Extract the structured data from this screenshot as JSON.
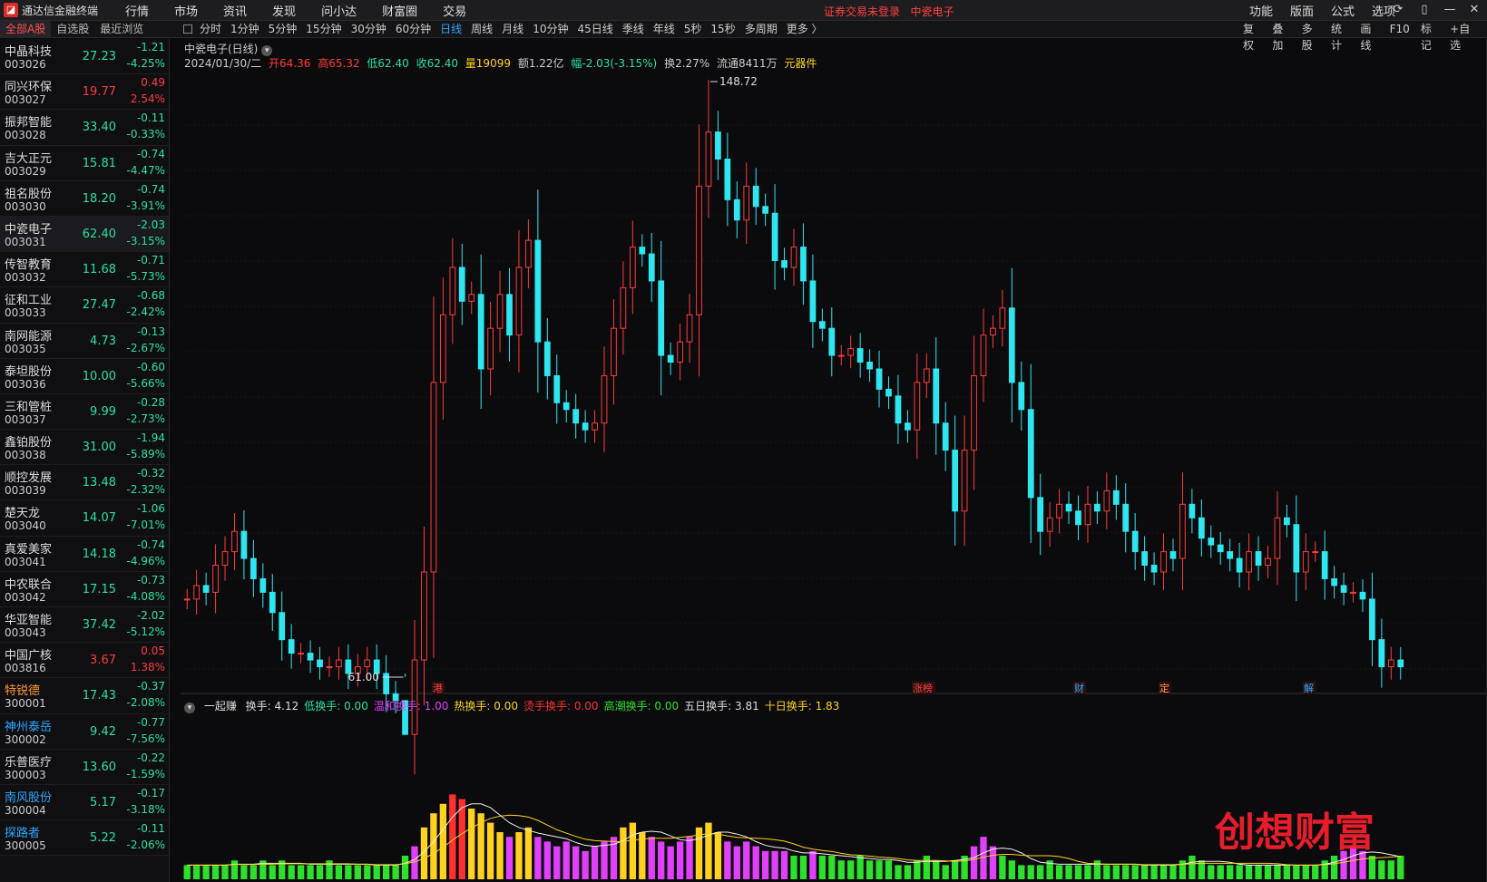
{
  "titlebar": {
    "app_title": "通达信金融终端",
    "menu": [
      "行情",
      "市场",
      "资讯",
      "发现",
      "问小达",
      "财富圈",
      "交易"
    ],
    "login_warning": "证券交易未登录",
    "login_stock": "中瓷电子",
    "sys_menu": [
      "功能",
      "版面",
      "公式",
      "选项"
    ]
  },
  "toolbar": {
    "stock_tabs": [
      "全部A股",
      "自选股",
      "最近浏览"
    ],
    "periods": [
      "分时",
      "1分钟",
      "5分钟",
      "15分钟",
      "30分钟",
      "60分钟",
      "日线",
      "周线",
      "月线",
      "10分钟",
      "45日线",
      "季线",
      "年线",
      "5秒",
      "15秒",
      "多周期",
      "更多 〉"
    ],
    "active_period": "日线",
    "right_tools": [
      "复权",
      "叠加",
      "多股",
      "统计",
      "画线",
      "F10",
      "标记",
      "+自选"
    ]
  },
  "stocks": [
    {
      "name": "中晶科技",
      "code": "003026",
      "price": "27.23",
      "chg": "-1.21",
      "pct": "-4.25%",
      "dir": "dn"
    },
    {
      "name": "同兴环保",
      "code": "003027",
      "price": "19.77",
      "chg": "0.49",
      "pct": "2.54%",
      "dir": "up"
    },
    {
      "name": "振邦智能",
      "code": "003028",
      "price": "33.40",
      "chg": "-0.11",
      "pct": "-0.33%",
      "dir": "dn"
    },
    {
      "name": "吉大正元",
      "code": "003029",
      "price": "15.81",
      "chg": "-0.74",
      "pct": "-4.47%",
      "dir": "dn"
    },
    {
      "name": "祖名股份",
      "code": "003030",
      "price": "18.20",
      "chg": "-0.74",
      "pct": "-3.91%",
      "dir": "dn"
    },
    {
      "name": "中瓷电子",
      "code": "003031",
      "price": "62.40",
      "chg": "-2.03",
      "pct": "-3.15%",
      "dir": "dn",
      "selected": true
    },
    {
      "name": "传智教育",
      "code": "003032",
      "price": "11.68",
      "chg": "-0.71",
      "pct": "-5.73%",
      "dir": "dn"
    },
    {
      "name": "征和工业",
      "code": "003033",
      "price": "27.47",
      "chg": "-0.68",
      "pct": "-2.42%",
      "dir": "dn"
    },
    {
      "name": "南网能源",
      "code": "003035",
      "price": "4.73",
      "chg": "-0.13",
      "pct": "-2.67%",
      "dir": "dn"
    },
    {
      "name": "泰坦股份",
      "code": "003036",
      "price": "10.00",
      "chg": "-0.60",
      "pct": "-5.66%",
      "dir": "dn"
    },
    {
      "name": "三和管桩",
      "code": "003037",
      "price": "9.99",
      "chg": "-0.28",
      "pct": "-2.73%",
      "dir": "dn"
    },
    {
      "name": "鑫铂股份",
      "code": "003038",
      "price": "31.00",
      "chg": "-1.94",
      "pct": "-5.89%",
      "dir": "dn"
    },
    {
      "name": "顺控发展",
      "code": "003039",
      "price": "13.48",
      "chg": "-0.32",
      "pct": "-2.32%",
      "dir": "dn"
    },
    {
      "name": "楚天龙",
      "code": "003040",
      "price": "14.07",
      "chg": "-1.06",
      "pct": "-7.01%",
      "dir": "dn"
    },
    {
      "name": "真爱美家",
      "code": "003041",
      "price": "14.18",
      "chg": "-0.74",
      "pct": "-4.96%",
      "dir": "dn"
    },
    {
      "name": "中农联合",
      "code": "003042",
      "price": "17.15",
      "chg": "-0.73",
      "pct": "-4.08%",
      "dir": "dn"
    },
    {
      "name": "华亚智能",
      "code": "003043",
      "price": "37.42",
      "chg": "-2.02",
      "pct": "-5.12%",
      "dir": "dn"
    },
    {
      "name": "中国广核",
      "code": "003816",
      "price": "3.67",
      "chg": "0.05",
      "pct": "1.38%",
      "dir": "up"
    },
    {
      "name": "特锐德",
      "code": "300001",
      "price": "17.43",
      "chg": "-0.37",
      "pct": "-2.08%",
      "dir": "dn",
      "namecolor": "#ff9a30"
    },
    {
      "name": "神州泰岳",
      "code": "300002",
      "price": "9.42",
      "chg": "-0.77",
      "pct": "-7.56%",
      "dir": "dn",
      "namecolor": "#2ea8ff"
    },
    {
      "name": "乐普医疗",
      "code": "300003",
      "price": "13.60",
      "chg": "-0.22",
      "pct": "-1.59%",
      "dir": "dn"
    },
    {
      "name": "南风股份",
      "code": "300004",
      "price": "5.17",
      "chg": "-0.17",
      "pct": "-3.18%",
      "dir": "dn",
      "namecolor": "#2ea8ff"
    },
    {
      "name": "探路者",
      "code": "300005",
      "price": "5.22",
      "chg": "-0.11",
      "pct": "-2.06%",
      "dir": "dn",
      "namecolor": "#2ea8ff"
    }
  ],
  "chart": {
    "title": "中瓷电子(日线)",
    "date": "2024/01/30/二",
    "open": "开64.36",
    "high": "高65.32",
    "low": "低62.40",
    "close": "收62.40",
    "volume": "量19099",
    "amount": "额1.22亿",
    "change": "幅-2.03(-3.15%)",
    "turnover": "换2.27%",
    "float": "流通8411万",
    "sector": "元器件",
    "max_label": "148.72",
    "min_label": "61.00",
    "events": [
      {
        "label": "港",
        "color": "#ff4040"
      },
      {
        "label": "涨榜",
        "color": "#ff4040"
      },
      {
        "label": "财",
        "color": "#2ea8ff"
      },
      {
        "label": "定",
        "color": "#ff9a30"
      },
      {
        "label": "解",
        "color": "#2ea8ff"
      }
    ],
    "ind_name": "一起赚",
    "ind_items": [
      {
        "text": "换手: 4.12",
        "color": "#dddddd"
      },
      {
        "text": "低换手: 0.00",
        "color": "#2ce0a0"
      },
      {
        "text": "温和换手: 1.00",
        "color": "#e040fb"
      },
      {
        "text": "热换手: 0.00",
        "color": "#ffd21f"
      },
      {
        "text": "烫手换手: 0.00",
        "color": "#ff3030"
      },
      {
        "text": "高潮换手: 0.00",
        "color": "#2ce02c"
      },
      {
        "text": "五日换手: 3.81",
        "color": "#dddddd"
      },
      {
        "text": "十日换手: 1.83",
        "color": "#ffd21f"
      }
    ],
    "watermark": "创想财富",
    "colors": {
      "up": "#ff3b3b",
      "down": "#2ee6f0"
    }
  },
  "chart_data": {
    "type": "candlestick",
    "title": "中瓷电子(日线)",
    "close_series": [
      72,
      74,
      73,
      77,
      79,
      82,
      78,
      75,
      73,
      70,
      66,
      64,
      64,
      63,
      62,
      62,
      63,
      61,
      62,
      63,
      61,
      58,
      57,
      52,
      63,
      76,
      104,
      114,
      121,
      116,
      117,
      106,
      112,
      117,
      111,
      121,
      125,
      110,
      105,
      101,
      100,
      98,
      97,
      98,
      105,
      112,
      118,
      124,
      123,
      119,
      108,
      107,
      110,
      114,
      133,
      141,
      137,
      131,
      128,
      133,
      130,
      129,
      122,
      121,
      124,
      119,
      113,
      112,
      108,
      108,
      109,
      107,
      106,
      103,
      102,
      98,
      97,
      104,
      106,
      98,
      94,
      85,
      94,
      105,
      111,
      112,
      115,
      104,
      100,
      87,
      82,
      84,
      86,
      85,
      83,
      86,
      85,
      88,
      86,
      82,
      79,
      77,
      76,
      79,
      78,
      86,
      84,
      81,
      80,
      79,
      78,
      76,
      79,
      77,
      78,
      84,
      83,
      76,
      79,
      79,
      75,
      74,
      73,
      73,
      72,
      66,
      62,
      63,
      62
    ],
    "high": 148.72,
    "low": 61.0,
    "turnover_bars": [
      3,
      3,
      3,
      3,
      3,
      4,
      3,
      3,
      4,
      3,
      4,
      3,
      3,
      3,
      3,
      4,
      3,
      3,
      3,
      3,
      3,
      3,
      3,
      5,
      7,
      11,
      14,
      16,
      18,
      17,
      15,
      14,
      12,
      10,
      9,
      10,
      11,
      9,
      8,
      7,
      8,
      7,
      6,
      7,
      8,
      9,
      11,
      12,
      10,
      9,
      8,
      7,
      8,
      9,
      11,
      12,
      10,
      8,
      7,
      8,
      7,
      6,
      6,
      6,
      5,
      5,
      6,
      5,
      5,
      4,
      4,
      5,
      4,
      4,
      4,
      3,
      3,
      4,
      5,
      4,
      3,
      4,
      5,
      7,
      9,
      7,
      5,
      4,
      3,
      3,
      3,
      4,
      3,
      3,
      3,
      3,
      4,
      3,
      3,
      3,
      3,
      3,
      3,
      3,
      3,
      4,
      5,
      4,
      3,
      3,
      3,
      3,
      3,
      3,
      3,
      3,
      3,
      3,
      3,
      3,
      4,
      5,
      6,
      7,
      6,
      5,
      4,
      4,
      5
    ]
  }
}
